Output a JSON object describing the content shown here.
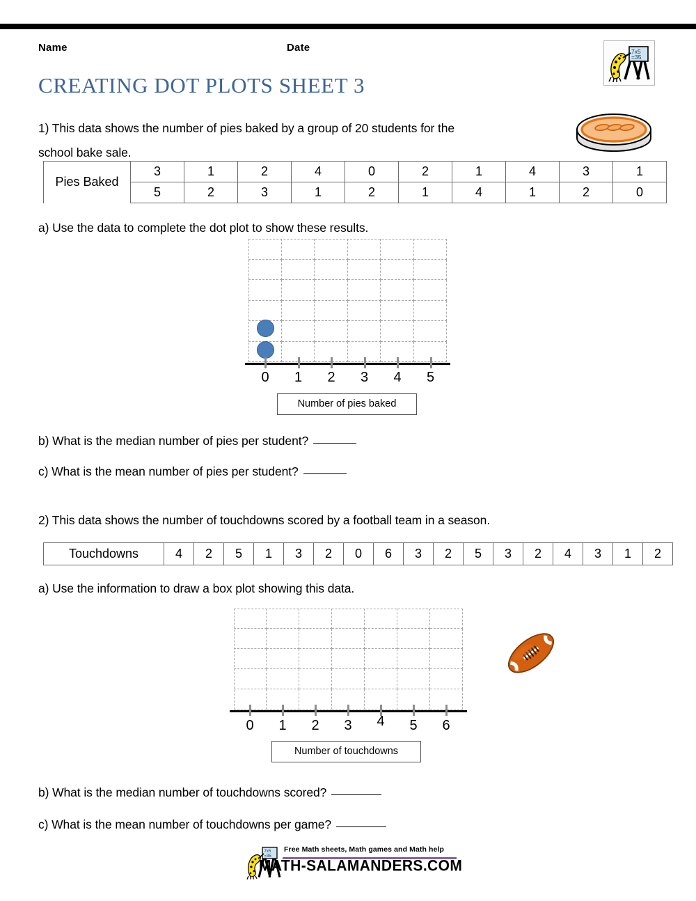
{
  "header": {
    "name_label": "Name",
    "date_label": "Date",
    "title": "CREATING DOT PLOTS SHEET 3",
    "logo_icon": "salamander-blackboard-logo",
    "logo_blackboard_line1": "7x5",
    "logo_blackboard_line2": "=35"
  },
  "question1": {
    "line1": "1) This data shows the number of pies baked by a group of 20 students for the",
    "line2": "school bake sale.",
    "clipart_icon": "pie-icon",
    "table": {
      "row_label": "Pies Baked",
      "row1": [
        "3",
        "1",
        "2",
        "4",
        "0",
        "2",
        "1",
        "4",
        "3",
        "1"
      ],
      "row2": [
        "5",
        "2",
        "3",
        "1",
        "2",
        "1",
        "4",
        "1",
        "2",
        "0"
      ]
    },
    "part_a": "a) Use the data to complete the dot plot to show these results.",
    "part_b": "b) What is the median number of pies per student?",
    "part_c": "c) What is the mean number of pies per student?"
  },
  "question2": {
    "line1": "2) This data shows the number of touchdowns scored by a football team in a season.",
    "clipart_icon": "football-icon",
    "table": {
      "row_label": "Touchdowns",
      "row1": [
        "4",
        "2",
        "5",
        "1",
        "3",
        "2",
        "0",
        "6",
        "3",
        "2",
        "5",
        "3",
        "2",
        "4",
        "3",
        "1",
        "2"
      ]
    },
    "part_a": "a) Use the information to draw a box plot showing this data.",
    "part_b": "b) What is the median number of touchdowns scored?",
    "part_c": "c) What is the mean number of touchdowns per game?"
  },
  "chart_data": [
    {
      "type": "scatter",
      "name": "pies-dot-plot",
      "title": "",
      "xlabel": "Number of pies baked",
      "ylabel": "",
      "x_ticks": [
        "0",
        "1",
        "2",
        "3",
        "4",
        "5"
      ],
      "xlim": [
        0,
        5
      ],
      "grid": true,
      "grid_columns": 6,
      "grid_rows": 6,
      "categories": [
        "0",
        "1",
        "2",
        "3",
        "4",
        "5"
      ],
      "values": [
        2,
        0,
        0,
        0,
        0,
        0
      ],
      "dot_color": "#4a7ebb",
      "note": "Two plotted dots stacked above 0; remaining dots to be completed by student"
    },
    {
      "type": "scatter",
      "name": "touchdowns-box-plot",
      "title": "",
      "xlabel": "Number of touchdowns",
      "ylabel": "",
      "x_ticks": [
        "0",
        "1",
        "2",
        "3",
        "4",
        "5",
        "6"
      ],
      "xlim": [
        0,
        6
      ],
      "grid": true,
      "grid_columns": 7,
      "grid_rows": 5,
      "categories": [
        "0",
        "1",
        "2",
        "3",
        "4",
        "5",
        "6"
      ],
      "values": [
        0,
        0,
        0,
        0,
        0,
        0,
        0
      ],
      "note": "Empty grid for student to draw a box plot"
    }
  ],
  "footer": {
    "tagline": "Free Math sheets, Math games and Math help",
    "url": "MATH-SALAMANDERS.COM",
    "logo_icon": "salamander-blackboard-logo",
    "rule_color": "#8064a2"
  },
  "colors": {
    "title": "#3c6498",
    "dot": "#4a7ebb",
    "grid": "#a8a8a8",
    "footer_rule": "#8064a2"
  }
}
